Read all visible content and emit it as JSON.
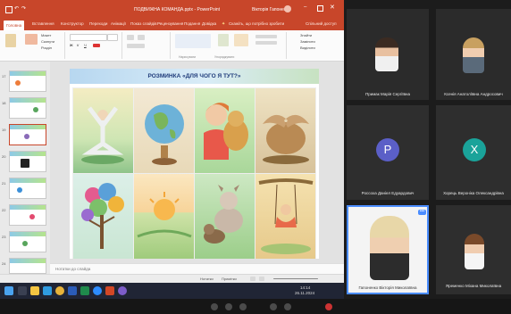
{
  "ppt": {
    "window_title": "ПОДВИЖНА КОМАНДА.pptx - PowerPoint",
    "user_name": "Вікторія Гапоненко",
    "tabs": [
      "Головна",
      "Вставлення",
      "Конструктор",
      "Переходи",
      "Анімації",
      "Показ слайдів",
      "Рецензування",
      "Подання",
      "Довідка"
    ],
    "active_tab": "Головна",
    "tell_me": "Скажіть, що потрібно зробити",
    "share": "Спільний доступ",
    "ribbon_left": [
      "Макет",
      "Скинути",
      "Розділ"
    ],
    "ribbon_right": [
      "Знайти",
      "Замінити",
      "Виділити"
    ],
    "ribbon_group_paragraph": "Нарисувати",
    "ribbon_group_arrange": "Упорядкувати",
    "slide_title": "РОЗМИНКА «ДЛЯ ЧОГО Я ТУТ?»",
    "notes_placeholder": "Нотатки до слайда",
    "status_notes": "Нотатки",
    "status_comments": "Примітки",
    "clock_time": "14:14",
    "clock_date": "26.11.2024"
  },
  "zoom": {
    "participants": [
      {
        "name": "Примак Марія Сергіївна",
        "type": "video"
      },
      {
        "name": "Ксенія Анатоліївна Андросович",
        "type": "video"
      },
      {
        "name": "Россохa Даніел Едуардович",
        "type": "avatar",
        "initial": "P",
        "color": "#5b5fc7"
      },
      {
        "name": "Хорець Вероніка Олександрівна",
        "type": "avatar",
        "initial": "X",
        "color": "#1aa39a"
      },
      {
        "name": "Гапоненко Вікторія Миколаївна",
        "type": "video",
        "active": true
      },
      {
        "name": "Яременко Міхана Миколаївна",
        "type": "video"
      }
    ]
  }
}
